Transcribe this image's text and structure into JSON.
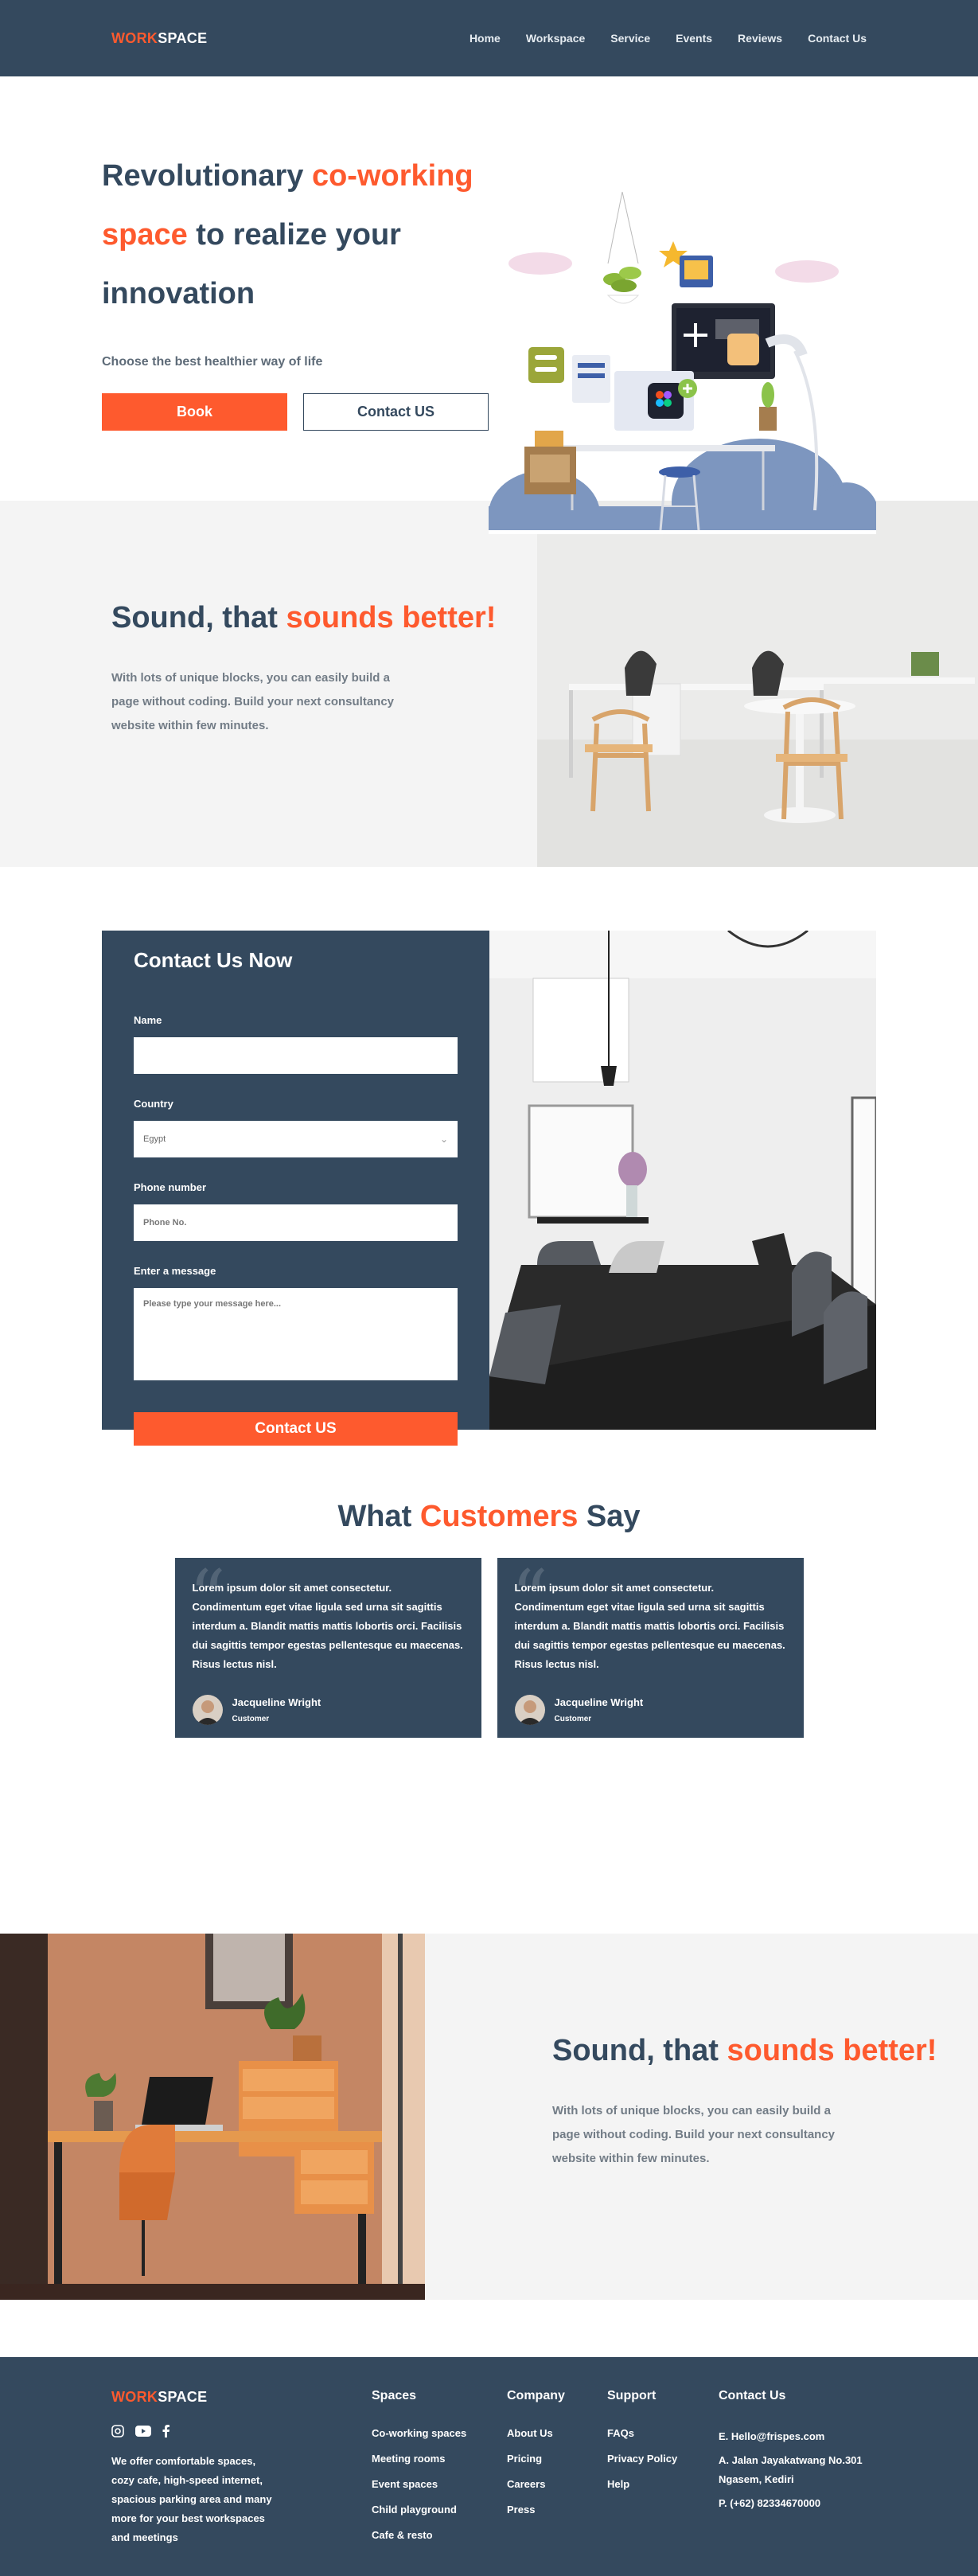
{
  "brand": {
    "logo_part1": "WORK",
    "logo_part2": "SPACE"
  },
  "nav": {
    "items": [
      "Home",
      "Workspace",
      "Service",
      "Events",
      "Reviews",
      "Contact Us"
    ]
  },
  "hero": {
    "title_part1": "Revolutionary ",
    "title_accent": "co-working space",
    "title_part2": " to realize your innovation",
    "subtitle": "Choose the best healthier way of life",
    "primary_button": "Book",
    "secondary_button": "Contact US"
  },
  "sound1": {
    "title_part1": "Sound, that ",
    "title_accent": "sounds better!",
    "body": "With lots of unique blocks, you can easily build a page without coding. Build your next consultancy website within few minutes."
  },
  "contact": {
    "title": "Contact Us Now",
    "name_label": "Name",
    "country_label": "Country",
    "country_value": "Egypt",
    "phone_label": "Phone number",
    "phone_placeholder": "Phone No.",
    "message_label": "Enter a message",
    "message_placeholder": "Please type your message here...",
    "submit": "Contact US"
  },
  "testimonials": {
    "title_part1": "What ",
    "title_accent": "Customers",
    "title_part2": " Say",
    "items": [
      {
        "text": "Lorem ipsum dolor sit amet consectetur. Condimentum eget vitae ligula sed urna sit sagittis interdum a. Blandit mattis mattis lobortis orci. Facilisis dui sagittis tempor egestas pellentesque eu maecenas. Risus lectus nisl.",
        "name": "Jacqueline Wright",
        "role": "Customer"
      },
      {
        "text": "Lorem ipsum dolor sit amet consectetur. Condimentum eget vitae ligula sed urna sit sagittis interdum a. Blandit mattis mattis lobortis orci. Facilisis dui sagittis tempor egestas pellentesque eu maecenas. Risus lectus nisl.",
        "name": "Jacqueline Wright",
        "role": "Customer"
      }
    ]
  },
  "sound2": {
    "title_part1": "Sound, that ",
    "title_accent": "sounds better!",
    "body": "With lots of unique blocks, you can easily build a page without coding. Build your next consultancy website within few minutes."
  },
  "footer": {
    "description": "We offer comfortable spaces, cozy cafe, high-speed internet, spacious parking area and many more for your best workspaces and meetings",
    "spaces": {
      "title": "Spaces",
      "links": [
        "Co-working spaces",
        "Meeting rooms",
        "Event spaces",
        "Child playground",
        "Cafe & resto"
      ]
    },
    "company": {
      "title": "Company",
      "links": [
        "About Us",
        "Pricing",
        "Careers",
        "Press"
      ]
    },
    "support": {
      "title": "Support",
      "links": [
        "FAQs",
        "Privacy Policy",
        "Help"
      ]
    },
    "contact": {
      "title": "Contact Us",
      "email": "E. Hello@frispes.com",
      "address": "A. Jalan Jayakatwang No.301 Ngasem, Kediri",
      "phone": "P. (+62) 82334670000"
    }
  },
  "colors": {
    "primary": "#34495e",
    "accent": "#fe5a2e",
    "light_bg": "#f4f4f4"
  }
}
